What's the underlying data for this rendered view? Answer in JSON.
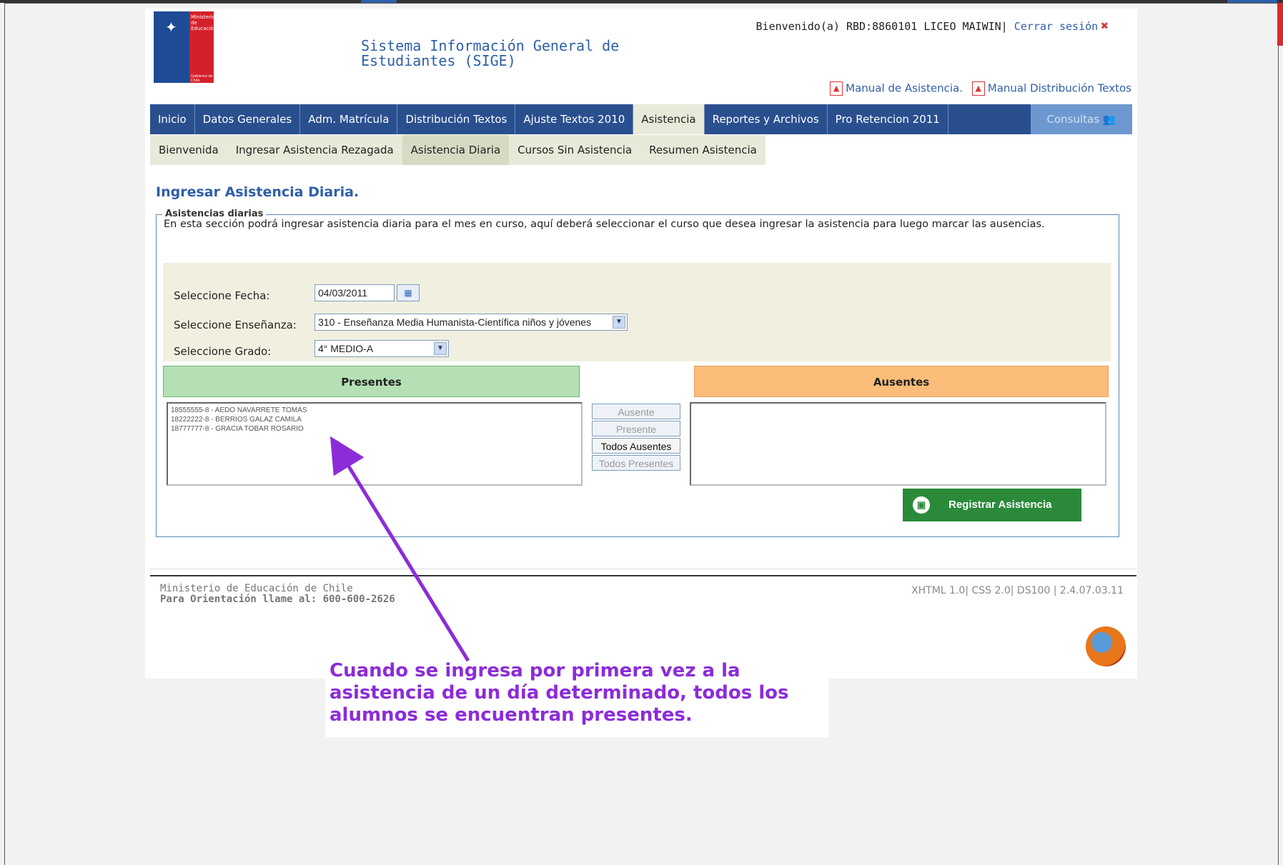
{
  "header": {
    "logo_text": "Ministerio de Educación",
    "logo_sub": "Gobierno de Chile",
    "system_title_line1": "Sistema Información General de",
    "system_title_line2": "Estudiantes (SIGE)",
    "welcome": "Bienvenido(a) RBD:8860101  LICEO MAIWIN|",
    "logout": "Cerrar sesión",
    "manual_asistencia": "Manual de Asistencia.",
    "manual_distribucion": "Manual Distribución Textos"
  },
  "menu": {
    "items": [
      "Inicio",
      "Datos Generales",
      "Adm. Matrícula",
      "Distribución Textos",
      "Ajuste Textos 2010",
      "Asistencia",
      "Reportes y Archivos",
      "Pro Retencion 2011"
    ],
    "consultas": "Consultas"
  },
  "submenu": {
    "items": [
      "Bienvenida",
      "Ingresar Asistencia Rezagada",
      "Asistencia Diaria",
      "Cursos Sin Asistencia",
      "Resumen Asistencia"
    ]
  },
  "main": {
    "title": "Ingresar Asistencia Diaria.",
    "legend": "Asistencias diarias",
    "intro": "En esta sección podrá ingresar asistencia diaria para el mes en curso, aquí deberá seleccionar el curso que desea ingresar la asistencia para luego marcar las ausencias.",
    "fecha_label": "Seleccione Fecha:",
    "fecha_value": "04/03/2011",
    "ensenanza_label": "Seleccione Enseñanza:",
    "ensenanza_value": "310 - Enseñanza Media Humanista-Científica niños y jóvenes",
    "grado_label": "Seleccione Grado:",
    "grado_value": "4° MEDIO-A",
    "presentes_header": "Presentes",
    "ausentes_header": "Ausentes",
    "presentes_list": [
      "18555555-8 - AEDO NAVARRETE TOMÁS",
      "18222222-8 - BERRIOS GALAZ CAMILA",
      "18777777-8 - GRACIA TOBAR ROSARIO"
    ],
    "btn_ausente": "Ausente",
    "btn_presente": "Presente",
    "btn_todos_ausentes": "Todos Ausentes",
    "btn_todos_presentes": "Todos Presentes",
    "btn_registrar": "Registrar Asistencia"
  },
  "footer": {
    "line1": "Ministerio de Educación de Chile",
    "line2": "Para Orientación llame al: 600-600-2626",
    "version": "XHTML 1.0| CSS 2.0| DS100 | 2.4.07.03.11"
  },
  "annotation": {
    "line1": "Cuando se ingresa por primera vez a la",
    "line2": "asistencia de un día determinado, todos los",
    "line3": "alumnos se encuentran presentes."
  },
  "colors": {
    "brand_blue": "#2a4f8f",
    "presentes_green": "#b5e0b5",
    "ausentes_orange": "#fdbd7a",
    "callout_purple": "#8c2cd9"
  }
}
